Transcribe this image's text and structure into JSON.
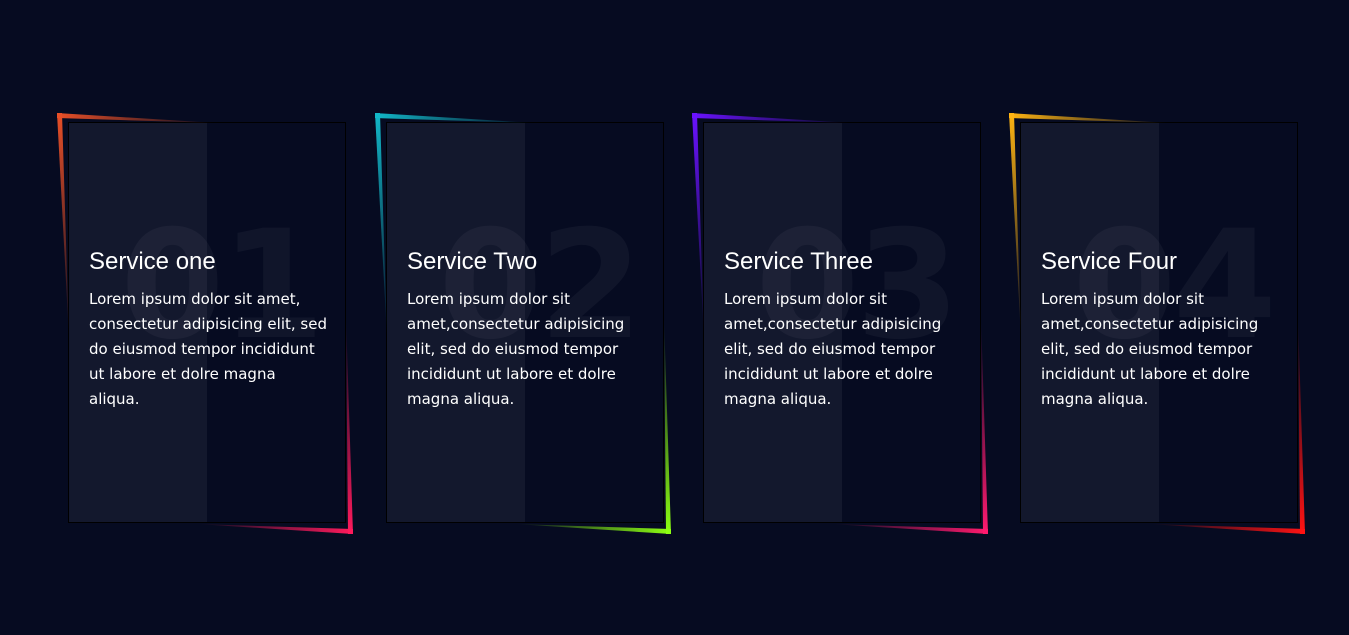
{
  "cards": [
    {
      "number": "01",
      "title": "Service one",
      "description": "Lorem ipsum dolor sit amet, consectetur adipisicing elit, sed do eiusmod tempor incididunt ut labore et dolre magna aliqua.",
      "accent_top": "#e84f27",
      "accent_bottom": "#ff1a5c"
    },
    {
      "number": "02",
      "title": "Service Two",
      "description": "Lorem ipsum dolor sit amet,consectetur adipisicing elit, sed do eiusmod tempor incididunt ut labore et dolre magna aliqua.",
      "accent_top": "#12b8c9",
      "accent_bottom": "#8cff12"
    },
    {
      "number": "03",
      "title": "Service Three",
      "description": "Lorem ipsum dolor sit amet,consectetur adipisicing elit, sed do eiusmod tempor incididunt ut labore et dolre magna aliqua.",
      "accent_top": "#6a12ff",
      "accent_bottom": "#ff1a6e"
    },
    {
      "number": "04",
      "title": "Service Four",
      "description": "Lorem ipsum dolor sit amet,consectetur adipisicing elit, sed do eiusmod tempor incididunt ut labore et dolre magna aliqua.",
      "accent_top": "#ffb412",
      "accent_bottom": "#ff1212"
    }
  ]
}
